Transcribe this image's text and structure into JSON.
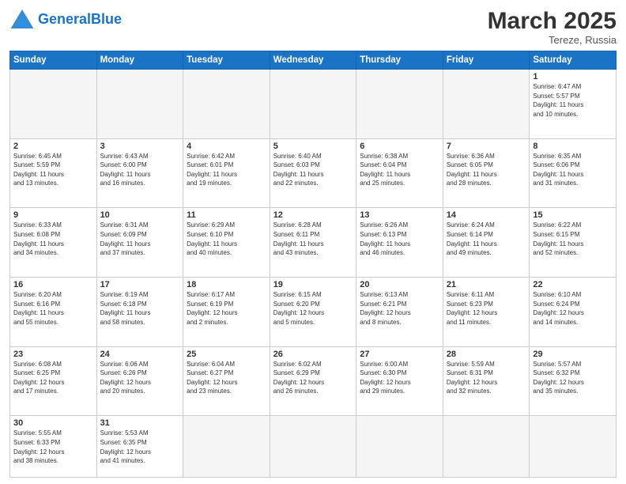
{
  "logo": {
    "general": "General",
    "blue": "Blue"
  },
  "title": "March 2025",
  "location": "Tereze, Russia",
  "weekdays": [
    "Sunday",
    "Monday",
    "Tuesday",
    "Wednesday",
    "Thursday",
    "Friday",
    "Saturday"
  ],
  "days": [
    {
      "num": "",
      "info": ""
    },
    {
      "num": "",
      "info": ""
    },
    {
      "num": "",
      "info": ""
    },
    {
      "num": "",
      "info": ""
    },
    {
      "num": "",
      "info": ""
    },
    {
      "num": "",
      "info": ""
    },
    {
      "num": "1",
      "info": "Sunrise: 6:47 AM\nSunset: 5:57 PM\nDaylight: 11 hours\nand 10 minutes."
    },
    {
      "num": "2",
      "info": "Sunrise: 6:45 AM\nSunset: 5:59 PM\nDaylight: 11 hours\nand 13 minutes."
    },
    {
      "num": "3",
      "info": "Sunrise: 6:43 AM\nSunset: 6:00 PM\nDaylight: 11 hours\nand 16 minutes."
    },
    {
      "num": "4",
      "info": "Sunrise: 6:42 AM\nSunset: 6:01 PM\nDaylight: 11 hours\nand 19 minutes."
    },
    {
      "num": "5",
      "info": "Sunrise: 6:40 AM\nSunset: 6:03 PM\nDaylight: 11 hours\nand 22 minutes."
    },
    {
      "num": "6",
      "info": "Sunrise: 6:38 AM\nSunset: 6:04 PM\nDaylight: 11 hours\nand 25 minutes."
    },
    {
      "num": "7",
      "info": "Sunrise: 6:36 AM\nSunset: 6:05 PM\nDaylight: 11 hours\nand 28 minutes."
    },
    {
      "num": "8",
      "info": "Sunrise: 6:35 AM\nSunset: 6:06 PM\nDaylight: 11 hours\nand 31 minutes."
    },
    {
      "num": "9",
      "info": "Sunrise: 6:33 AM\nSunset: 6:08 PM\nDaylight: 11 hours\nand 34 minutes."
    },
    {
      "num": "10",
      "info": "Sunrise: 6:31 AM\nSunset: 6:09 PM\nDaylight: 11 hours\nand 37 minutes."
    },
    {
      "num": "11",
      "info": "Sunrise: 6:29 AM\nSunset: 6:10 PM\nDaylight: 11 hours\nand 40 minutes."
    },
    {
      "num": "12",
      "info": "Sunrise: 6:28 AM\nSunset: 6:11 PM\nDaylight: 11 hours\nand 43 minutes."
    },
    {
      "num": "13",
      "info": "Sunrise: 6:26 AM\nSunset: 6:13 PM\nDaylight: 11 hours\nand 46 minutes."
    },
    {
      "num": "14",
      "info": "Sunrise: 6:24 AM\nSunset: 6:14 PM\nDaylight: 11 hours\nand 49 minutes."
    },
    {
      "num": "15",
      "info": "Sunrise: 6:22 AM\nSunset: 6:15 PM\nDaylight: 11 hours\nand 52 minutes."
    },
    {
      "num": "16",
      "info": "Sunrise: 6:20 AM\nSunset: 6:16 PM\nDaylight: 11 hours\nand 55 minutes."
    },
    {
      "num": "17",
      "info": "Sunrise: 6:19 AM\nSunset: 6:18 PM\nDaylight: 11 hours\nand 58 minutes."
    },
    {
      "num": "18",
      "info": "Sunrise: 6:17 AM\nSunset: 6:19 PM\nDaylight: 12 hours\nand 2 minutes."
    },
    {
      "num": "19",
      "info": "Sunrise: 6:15 AM\nSunset: 6:20 PM\nDaylight: 12 hours\nand 5 minutes."
    },
    {
      "num": "20",
      "info": "Sunrise: 6:13 AM\nSunset: 6:21 PM\nDaylight: 12 hours\nand 8 minutes."
    },
    {
      "num": "21",
      "info": "Sunrise: 6:11 AM\nSunset: 6:23 PM\nDaylight: 12 hours\nand 11 minutes."
    },
    {
      "num": "22",
      "info": "Sunrise: 6:10 AM\nSunset: 6:24 PM\nDaylight: 12 hours\nand 14 minutes."
    },
    {
      "num": "23",
      "info": "Sunrise: 6:08 AM\nSunset: 6:25 PM\nDaylight: 12 hours\nand 17 minutes."
    },
    {
      "num": "24",
      "info": "Sunrise: 6:06 AM\nSunset: 6:26 PM\nDaylight: 12 hours\nand 20 minutes."
    },
    {
      "num": "25",
      "info": "Sunrise: 6:04 AM\nSunset: 6:27 PM\nDaylight: 12 hours\nand 23 minutes."
    },
    {
      "num": "26",
      "info": "Sunrise: 6:02 AM\nSunset: 6:29 PM\nDaylight: 12 hours\nand 26 minutes."
    },
    {
      "num": "27",
      "info": "Sunrise: 6:00 AM\nSunset: 6:30 PM\nDaylight: 12 hours\nand 29 minutes."
    },
    {
      "num": "28",
      "info": "Sunrise: 5:59 AM\nSunset: 6:31 PM\nDaylight: 12 hours\nand 32 minutes."
    },
    {
      "num": "29",
      "info": "Sunrise: 5:57 AM\nSunset: 6:32 PM\nDaylight: 12 hours\nand 35 minutes."
    },
    {
      "num": "30",
      "info": "Sunrise: 5:55 AM\nSunset: 6:33 PM\nDaylight: 12 hours\nand 38 minutes."
    },
    {
      "num": "31",
      "info": "Sunrise: 5:53 AM\nSunset: 6:35 PM\nDaylight: 12 hours\nand 41 minutes."
    },
    {
      "num": "",
      "info": ""
    },
    {
      "num": "",
      "info": ""
    },
    {
      "num": "",
      "info": ""
    },
    {
      "num": "",
      "info": ""
    },
    {
      "num": "",
      "info": ""
    }
  ]
}
